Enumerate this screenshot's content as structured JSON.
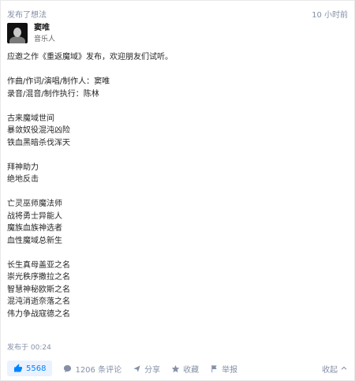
{
  "header": {
    "action": "发布了想法",
    "time": "10 小时前"
  },
  "author": {
    "name": "窦唯",
    "role": "音乐人"
  },
  "content": {
    "lines": [
      "应邀之作《重返魔域》发布，欢迎朋友们试听。",
      "",
      "作曲/作词/演唱/制作人：窦唯",
      "录音/混音/制作执行：陈林",
      "",
      "古来魔域世间",
      "暴敛奴役混沌凶险",
      "铁血黑暗杀伐浑天",
      "",
      "拜神助力",
      "绝地反击",
      "",
      "亡灵巫师魔法师",
      "战将勇士异能人",
      "魔族血族神选者",
      "血性魔域总新生",
      "",
      "长生真母盖亚之名",
      "崇光秩序撒拉之名",
      "智慧神秘欧斯之名",
      "混沌消逝奈落之名",
      "伟力争战寇德之名"
    ]
  },
  "posted": "发布于 00:24",
  "actions": {
    "vote_count": "5568",
    "comments": "1206 条评论",
    "share": "分享",
    "favorite": "收藏",
    "report": "举报",
    "collapse": "收起"
  },
  "colors": {
    "accent": "#0084ff",
    "muted": "#8590a6"
  }
}
